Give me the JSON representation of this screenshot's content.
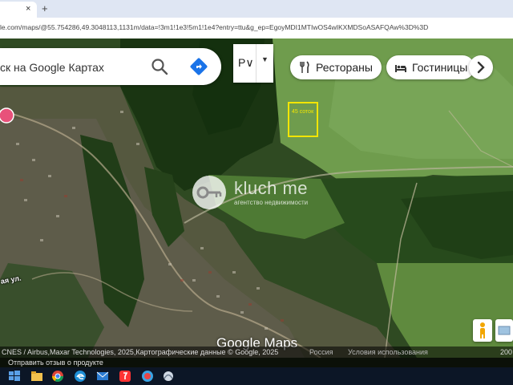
{
  "browser": {
    "tab_close_glyph": "×",
    "new_tab_glyph": "+",
    "url": "le.com/maps/@55.754286,49.3048113,1131m/data=!3m1!1e3!5m1!1e4?entry=ttu&g_ep=EgoyMDI1MTIwOS4wIKXMDSoASAFQAw%3D%3D"
  },
  "search": {
    "text": "ск на Google Картах",
    "icons": [
      "search-icon",
      "directions-icon"
    ]
  },
  "layers": {
    "label": "Р∨",
    "chevron": "▼"
  },
  "chips": [
    {
      "label": "Рестораны",
      "icon": "restaurant-icon"
    },
    {
      "label": "Гостиницы",
      "icon": "hotel-icon"
    }
  ],
  "chips_next_icon": "chevron-right-icon",
  "map": {
    "plot_label": "45 соток",
    "street_label": "ая ул.",
    "watermark": {
      "name": "kluch me",
      "subtitle": "агентство недвижимости",
      "icon": "key-icon"
    },
    "logo": "Google Maps",
    "plot_color": "#f2e500"
  },
  "attribution": {
    "imagery": "CNES / Airbus,Maxar Technologies, 2025,Картографические данные © Google, 2025",
    "country": "Россия",
    "terms": "Условия использования",
    "scale": "200"
  },
  "feedback": "Отправить отзыв о продукте",
  "taskbar_icons": [
    "start-icon",
    "file-explorer-icon",
    "chrome-icon",
    "edge-icon",
    "mail-icon",
    "yandex-icon",
    "antivirus-icon",
    "network-icon"
  ]
}
